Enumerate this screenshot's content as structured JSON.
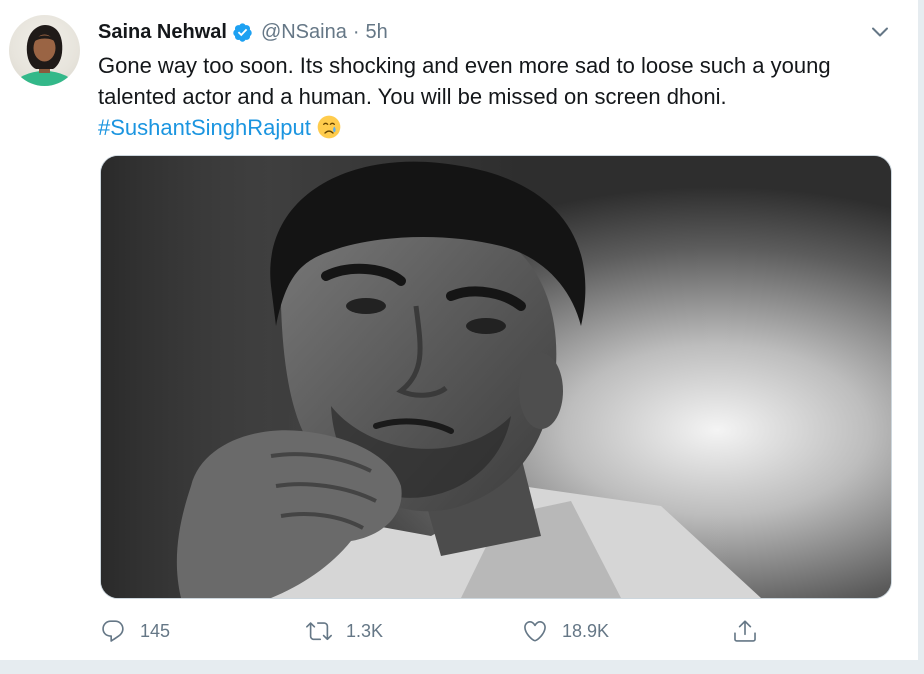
{
  "tweet": {
    "author_name": "Saina Nehwal",
    "handle": "@NSaina",
    "separator": "·",
    "time": "5h",
    "text_line1": "Gone way too soon. Its shocking and even more sad to loose such a young",
    "text_line2": "talented actor and a human. You will be missed on screen dhoni.",
    "hashtag": "#SushantSinghRajput",
    "emoji": "crying-face-emoji"
  },
  "actions": {
    "reply_count": "145",
    "retweet_count": "1.3K",
    "like_count": "18.9K"
  },
  "icons": {
    "verified": "verified-badge-icon",
    "caret": "chevron-down-icon",
    "reply": "reply-icon",
    "retweet": "retweet-icon",
    "like": "heart-icon",
    "share": "share-icon"
  },
  "colors": {
    "link": "#1b95e0",
    "verified": "#1da1f2",
    "secondary_text": "#657786",
    "primary_text": "#14171a",
    "background": "#e6ecf0"
  }
}
